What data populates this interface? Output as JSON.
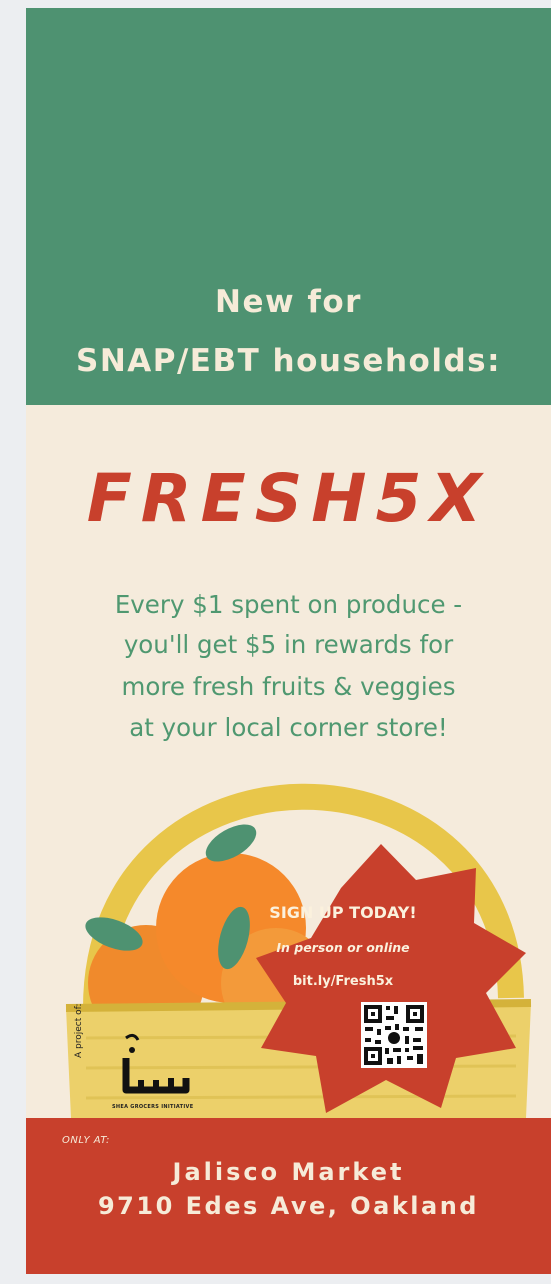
{
  "header": {
    "line1": "New for",
    "line2": "SNAP/EBT households:"
  },
  "brand": "FRESH5X",
  "description": {
    "line1": "Every $1 spent on produce -",
    "line2": "you'll get $5 in rewards for",
    "line3": "more fresh fruits & veggies",
    "line4": "at your local corner store!"
  },
  "callout": {
    "title": "SIGN UP TODAY!",
    "subtitle": "In person or online",
    "link": "bit.ly/Fresh5x"
  },
  "project": {
    "label": "A project of:",
    "org_name": "SHEA GROCERS INITIATIVE"
  },
  "footer": {
    "only_at": "ONLY AT:",
    "store_name": "Jalisco Market",
    "address": "9710 Edes Ave, Oakland"
  },
  "colors": {
    "green": "#4e9271",
    "cream": "#f5ebdc",
    "red": "#c8402c",
    "text_green": "#4f9870",
    "basket_yellow": "#e8c64a",
    "orange": "#f08a2c"
  },
  "icons": [
    "basket-illustration",
    "orange-fruit",
    "leaf",
    "starburst",
    "qr-code",
    "organization-logo"
  ]
}
